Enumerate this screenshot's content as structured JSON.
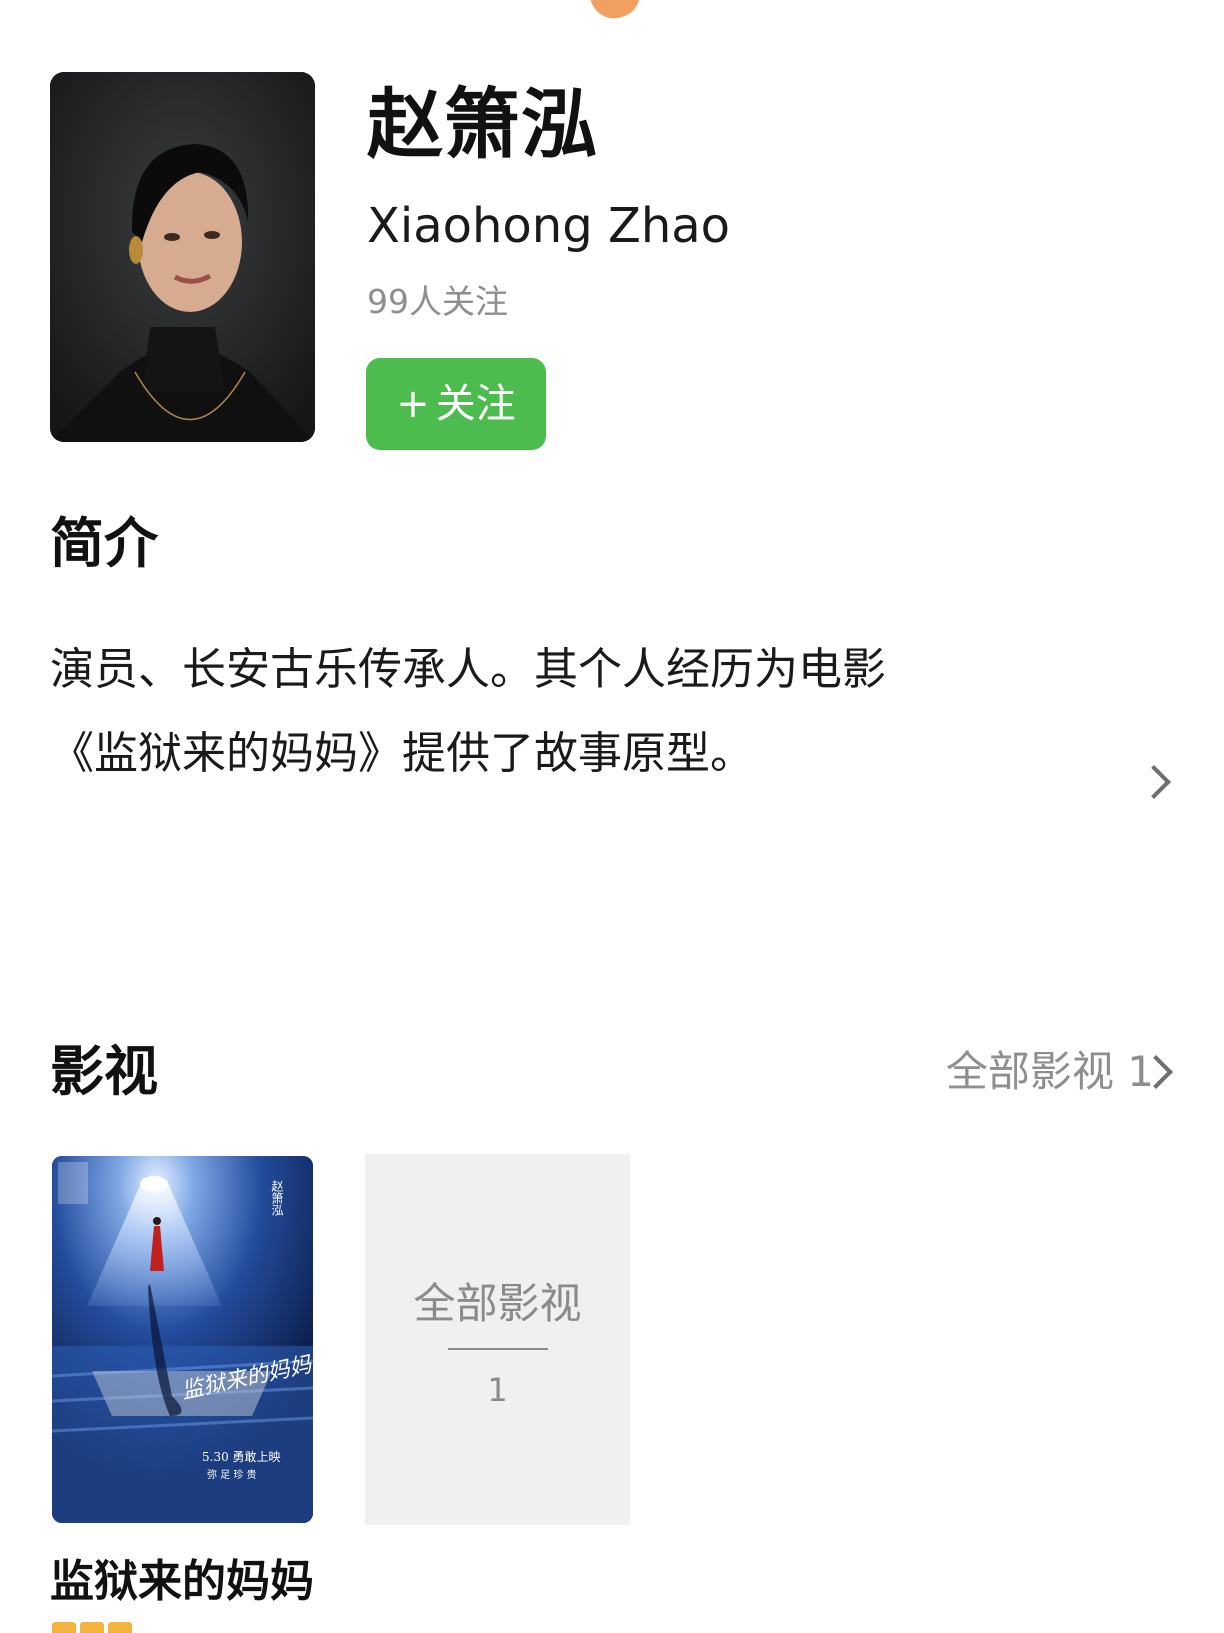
{
  "profile": {
    "name_zh": "赵箫泓",
    "name_en": "Xiaohong Zhao",
    "followers": "99人关注",
    "follow_button": "关注",
    "follow_plus": "+"
  },
  "intro": {
    "title": "简介",
    "lines": [
      "演员、长安古乐传承人。其个人经历为电影",
      "《监狱来的妈妈》提供了故事原型。"
    ]
  },
  "works": {
    "title": "影视",
    "all_link": "全部影视 1",
    "card_label": "全部影视",
    "card_count": "1",
    "items": [
      {
        "title": "监狱来的妈妈",
        "poster_text": {
          "credit": "赵箫泓",
          "title_art": "监狱来的妈妈",
          "release": "5.30 勇敢上映",
          "tagline": "弥 足 珍 贵"
        }
      }
    ]
  },
  "colors": {
    "accent_green": "#4cbc4e",
    "muted_text": "#8e8e8e",
    "card_bg": "#f0f0f0",
    "top_accent": "#f0a060"
  }
}
